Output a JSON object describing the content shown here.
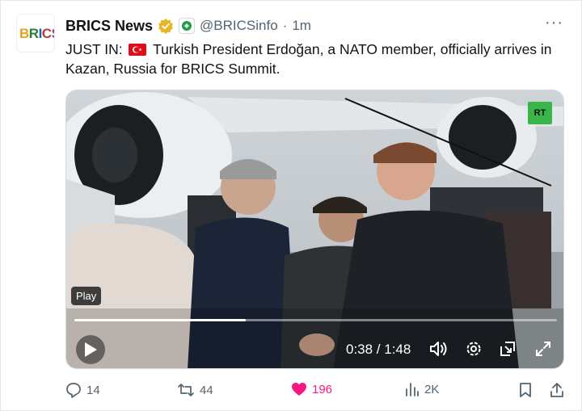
{
  "post": {
    "avatar_text": [
      "B",
      "R",
      "I",
      "C",
      "S"
    ],
    "author_name": "BRICS News",
    "handle": "@BRICSinfo",
    "separator": "·",
    "time": "1m",
    "more_label": "···",
    "text_prefix": "JUST IN:",
    "text_body": "Turkish President Erdoğan, a NATO member, officially arrives in Kazan, Russia for BRICS Summit."
  },
  "video": {
    "watermark": "RT",
    "play_label": "Play",
    "timecode": "0:38 / 1:48",
    "progress_fraction": 0.355
  },
  "actions": {
    "replies": "14",
    "reposts": "44",
    "likes": "196",
    "views": "2K"
  },
  "colors": {
    "like_active": "#f91880",
    "muted": "#536471",
    "verified_gold": "#e8b623"
  },
  "icons": [
    "verified-badge-icon",
    "affiliate-icon",
    "more-icon",
    "play-icon",
    "volume-icon",
    "settings-icon",
    "pip-icon",
    "fullscreen-icon",
    "reply-icon",
    "repost-icon",
    "like-icon",
    "views-icon",
    "bookmark-icon",
    "share-icon"
  ]
}
